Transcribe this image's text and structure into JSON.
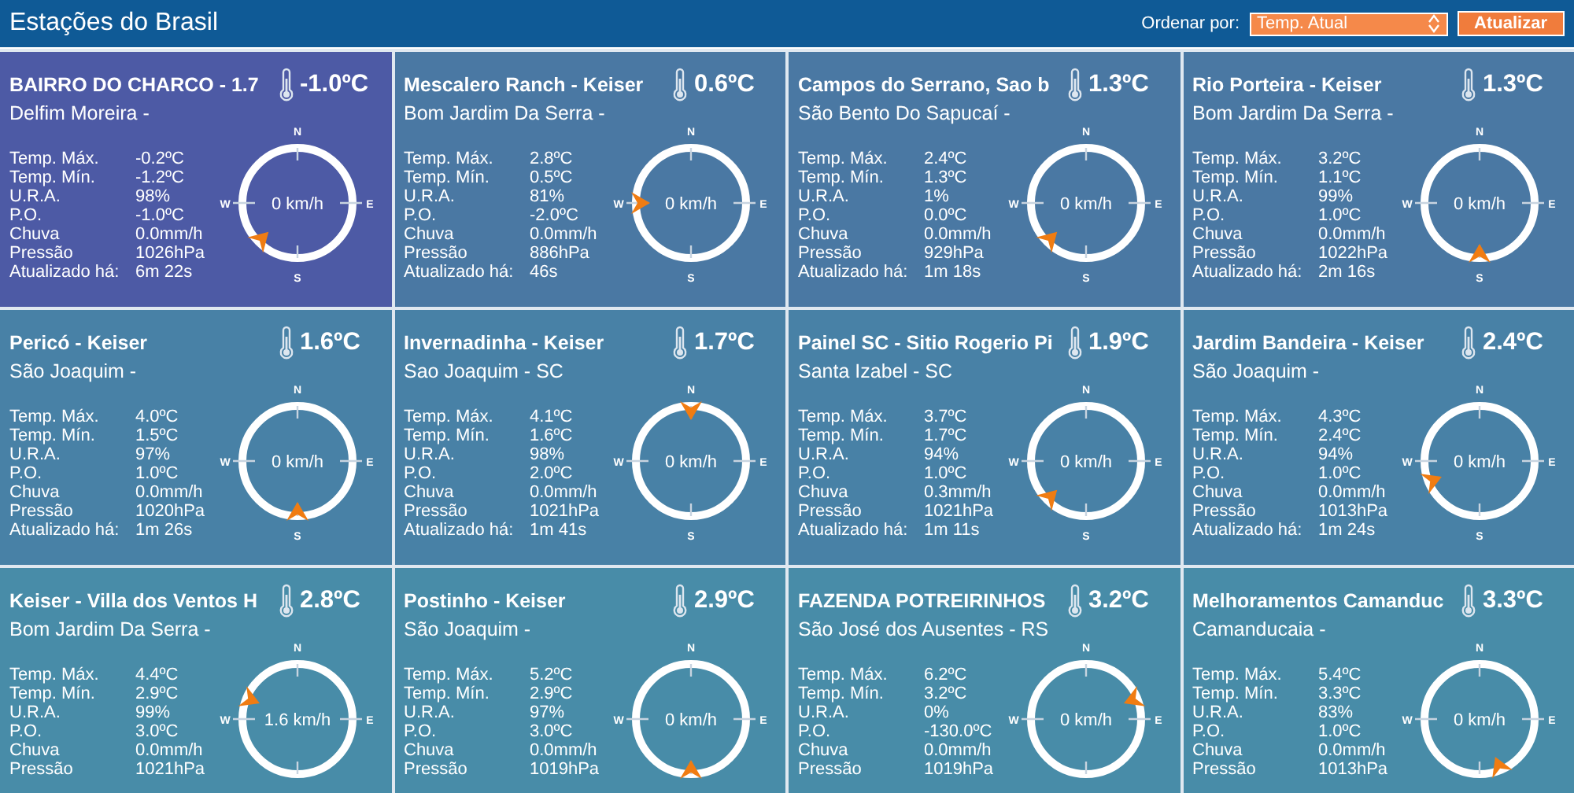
{
  "header": {
    "title": "Estações do Brasil",
    "sort_label": "Ordenar por:",
    "sort_value": "Temp. Atual",
    "refresh_button": "Atualizar"
  },
  "cards": [
    {
      "name": "BAIRRO DO CHARCO - 1.7",
      "temp": "-1.0ºC",
      "location": "Delfim Moreira -",
      "selected": true,
      "wind": {
        "kind": "sw",
        "speed": "0 km/h",
        "n": "N",
        "e": "E",
        "s": "S",
        "w": "W"
      },
      "stats": [
        {
          "label": "Temp. Máx.",
          "value": "-0.2ºC"
        },
        {
          "label": "Temp. Mín.",
          "value": "-1.2ºC"
        },
        {
          "label": "U.R.A.",
          "value": "98%"
        },
        {
          "label": "P.O.",
          "value": "-1.0ºC"
        },
        {
          "label": "Chuva",
          "value": "0.0mm/h"
        },
        {
          "label": "Pressão",
          "value": "1026hPa"
        },
        {
          "label": "Atualizado há:",
          "value": "6m 22s"
        }
      ]
    },
    {
      "name": "Mescalero Ranch - Keiser",
      "temp": "0.6ºC",
      "location": "Bom Jardim Da Serra -",
      "selected": false,
      "wind": {
        "kind": "w",
        "speed": "0 km/h",
        "n": "N",
        "e": "E",
        "s": "S",
        "w": "W"
      },
      "stats": [
        {
          "label": "Temp. Máx.",
          "value": "2.8ºC"
        },
        {
          "label": "Temp. Mín.",
          "value": "0.5ºC"
        },
        {
          "label": "U.R.A.",
          "value": "81%"
        },
        {
          "label": "P.O.",
          "value": "-2.0ºC"
        },
        {
          "label": "Chuva",
          "value": "0.0mm/h"
        },
        {
          "label": "Pressão",
          "value": "886hPa"
        },
        {
          "label": "Atualizado há:",
          "value": "46s"
        }
      ]
    },
    {
      "name": "Campos do Serrano, Sao b",
      "temp": "1.3ºC",
      "location": "São Bento Do Sapucaí -",
      "selected": false,
      "wind": {
        "kind": "sw",
        "speed": "0 km/h",
        "n": "N",
        "e": "E",
        "s": "S",
        "w": "W"
      },
      "stats": [
        {
          "label": "Temp. Máx.",
          "value": "2.4ºC"
        },
        {
          "label": "Temp. Mín.",
          "value": "1.3ºC"
        },
        {
          "label": "U.R.A.",
          "value": "1%"
        },
        {
          "label": "P.O.",
          "value": "0.0ºC"
        },
        {
          "label": "Chuva",
          "value": "0.0mm/h"
        },
        {
          "label": "Pressão",
          "value": "929hPa"
        },
        {
          "label": "Atualizado há:",
          "value": "1m 18s"
        }
      ]
    },
    {
      "name": "Rio Porteira - Keiser",
      "temp": "1.3ºC",
      "location": "Bom Jardim Da Serra -",
      "selected": false,
      "wind": {
        "kind": "s",
        "speed": "0 km/h",
        "n": "N",
        "e": "E",
        "s": "S",
        "w": "W"
      },
      "stats": [
        {
          "label": "Temp. Máx.",
          "value": "3.2ºC"
        },
        {
          "label": "Temp. Mín.",
          "value": "1.1ºC"
        },
        {
          "label": "U.R.A.",
          "value": "99%"
        },
        {
          "label": "P.O.",
          "value": "1.0ºC"
        },
        {
          "label": "Chuva",
          "value": "0.0mm/h"
        },
        {
          "label": "Pressão",
          "value": "1022hPa"
        },
        {
          "label": "Atualizado há:",
          "value": "2m 16s"
        }
      ]
    },
    {
      "name": "Pericó - Keiser",
      "temp": "1.6ºC",
      "location": "São Joaquim -",
      "selected": false,
      "wind": {
        "kind": "s",
        "speed": "0 km/h",
        "n": "N",
        "e": "E",
        "s": "S",
        "w": "W"
      },
      "stats": [
        {
          "label": "Temp. Máx.",
          "value": "4.0ºC"
        },
        {
          "label": "Temp. Mín.",
          "value": "1.5ºC"
        },
        {
          "label": "U.R.A.",
          "value": "97%"
        },
        {
          "label": "P.O.",
          "value": "1.0ºC"
        },
        {
          "label": "Chuva",
          "value": "0.0mm/h"
        },
        {
          "label": "Pressão",
          "value": "1020hPa"
        },
        {
          "label": "Atualizado há:",
          "value": "1m 26s"
        }
      ]
    },
    {
      "name": "Invernadinha - Keiser",
      "temp": "1.7ºC",
      "location": "Sao Joaquim - SC",
      "selected": false,
      "wind": {
        "kind": "n",
        "speed": "0 km/h",
        "n": "N",
        "e": "E",
        "s": "S",
        "w": "W"
      },
      "stats": [
        {
          "label": "Temp. Máx.",
          "value": "4.1ºC"
        },
        {
          "label": "Temp. Mín.",
          "value": "1.6ºC"
        },
        {
          "label": "U.R.A.",
          "value": "98%"
        },
        {
          "label": "P.O.",
          "value": "2.0ºC"
        },
        {
          "label": "Chuva",
          "value": "0.0mm/h"
        },
        {
          "label": "Pressão",
          "value": "1021hPa"
        },
        {
          "label": "Atualizado há:",
          "value": "1m 41s"
        }
      ]
    },
    {
      "name": "Painel SC - Sitio Rogerio Pi",
      "temp": "1.9ºC",
      "location": "Santa Izabel - SC",
      "selected": false,
      "wind": {
        "kind": "sw",
        "speed": "0 km/h",
        "n": "N",
        "e": "E",
        "s": "S",
        "w": "W"
      },
      "stats": [
        {
          "label": "Temp. Máx.",
          "value": "3.7ºC"
        },
        {
          "label": "Temp. Mín.",
          "value": "1.7ºC"
        },
        {
          "label": "U.R.A.",
          "value": "94%"
        },
        {
          "label": "P.O.",
          "value": "1.0ºC"
        },
        {
          "label": "Chuva",
          "value": "0.3mm/h"
        },
        {
          "label": "Pressão",
          "value": "1021hPa"
        },
        {
          "label": "Atualizado há:",
          "value": "1m 11s"
        }
      ]
    },
    {
      "name": "Jardim Bandeira - Keiser",
      "temp": "2.4ºC",
      "location": "São Joaquim -",
      "selected": false,
      "wind": {
        "kind": "wsw",
        "speed": "0 km/h",
        "n": "N",
        "e": "E",
        "s": "S",
        "w": "W"
      },
      "stats": [
        {
          "label": "Temp. Máx.",
          "value": "4.3ºC"
        },
        {
          "label": "Temp. Mín.",
          "value": "2.4ºC"
        },
        {
          "label": "U.R.A.",
          "value": "94%"
        },
        {
          "label": "P.O.",
          "value": "1.0ºC"
        },
        {
          "label": "Chuva",
          "value": "0.0mm/h"
        },
        {
          "label": "Pressão",
          "value": "1013hPa"
        },
        {
          "label": "Atualizado há:",
          "value": "1m 24s"
        }
      ]
    },
    {
      "name": "Keiser - Villa dos Ventos H",
      "temp": "2.8ºC",
      "location": "Bom Jardim Da Serra -",
      "selected": false,
      "wind": {
        "kind": "wnw",
        "speed": "1.6 km/h",
        "n": "N",
        "e": "E",
        "w": "W"
      },
      "stats": [
        {
          "label": "Temp. Máx.",
          "value": "4.4ºC"
        },
        {
          "label": "Temp. Mín.",
          "value": "2.9ºC"
        },
        {
          "label": "U.R.A.",
          "value": "99%"
        },
        {
          "label": "P.O.",
          "value": "3.0ºC"
        },
        {
          "label": "Chuva",
          "value": "0.0mm/h"
        },
        {
          "label": "Pressão",
          "value": "1021hPa"
        }
      ]
    },
    {
      "name": "Postinho - Keiser",
      "temp": "2.9ºC",
      "location": "São Joaquim -",
      "selected": false,
      "wind": {
        "kind": "s",
        "speed": "0 km/h",
        "n": "N",
        "e": "E",
        "w": "W"
      },
      "stats": [
        {
          "label": "Temp. Máx.",
          "value": "5.2ºC"
        },
        {
          "label": "Temp. Mín.",
          "value": "2.9ºC"
        },
        {
          "label": "U.R.A.",
          "value": "97%"
        },
        {
          "label": "P.O.",
          "value": "3.0ºC"
        },
        {
          "label": "Chuva",
          "value": "0.0mm/h"
        },
        {
          "label": "Pressão",
          "value": "1019hPa"
        }
      ]
    },
    {
      "name": "FAZENDA POTREIRINHOS",
      "temp": "3.2ºC",
      "location": "São José dos Ausentes - RS",
      "selected": false,
      "wind": {
        "kind": "ene",
        "speed": "0 km/h",
        "n": "N",
        "e": "E",
        "w": "W"
      },
      "stats": [
        {
          "label": "Temp. Máx.",
          "value": "6.2ºC"
        },
        {
          "label": "Temp. Mín.",
          "value": "3.2ºC"
        },
        {
          "label": "U.R.A.",
          "value": "0%"
        },
        {
          "label": "P.O.",
          "value": "-130.0ºC"
        },
        {
          "label": "Chuva",
          "value": "0.0mm/h"
        },
        {
          "label": "Pressão",
          "value": "1019hPa"
        }
      ]
    },
    {
      "name": "Melhoramentos Camanduc",
      "temp": "3.3ºC",
      "location": "Camanducaia -",
      "selected": false,
      "wind": {
        "kind": "sse",
        "speed": "0 km/h",
        "n": "N",
        "e": "E",
        "w": "W"
      },
      "stats": [
        {
          "label": "Temp. Máx.",
          "value": "5.4ºC"
        },
        {
          "label": "Temp. Mín.",
          "value": "3.3ºC"
        },
        {
          "label": "U.R.A.",
          "value": "83%"
        },
        {
          "label": "P.O.",
          "value": "1.0ºC"
        },
        {
          "label": "Chuva",
          "value": "0.0mm/h"
        },
        {
          "label": "Pressão",
          "value": "1013hPa"
        }
      ]
    }
  ]
}
